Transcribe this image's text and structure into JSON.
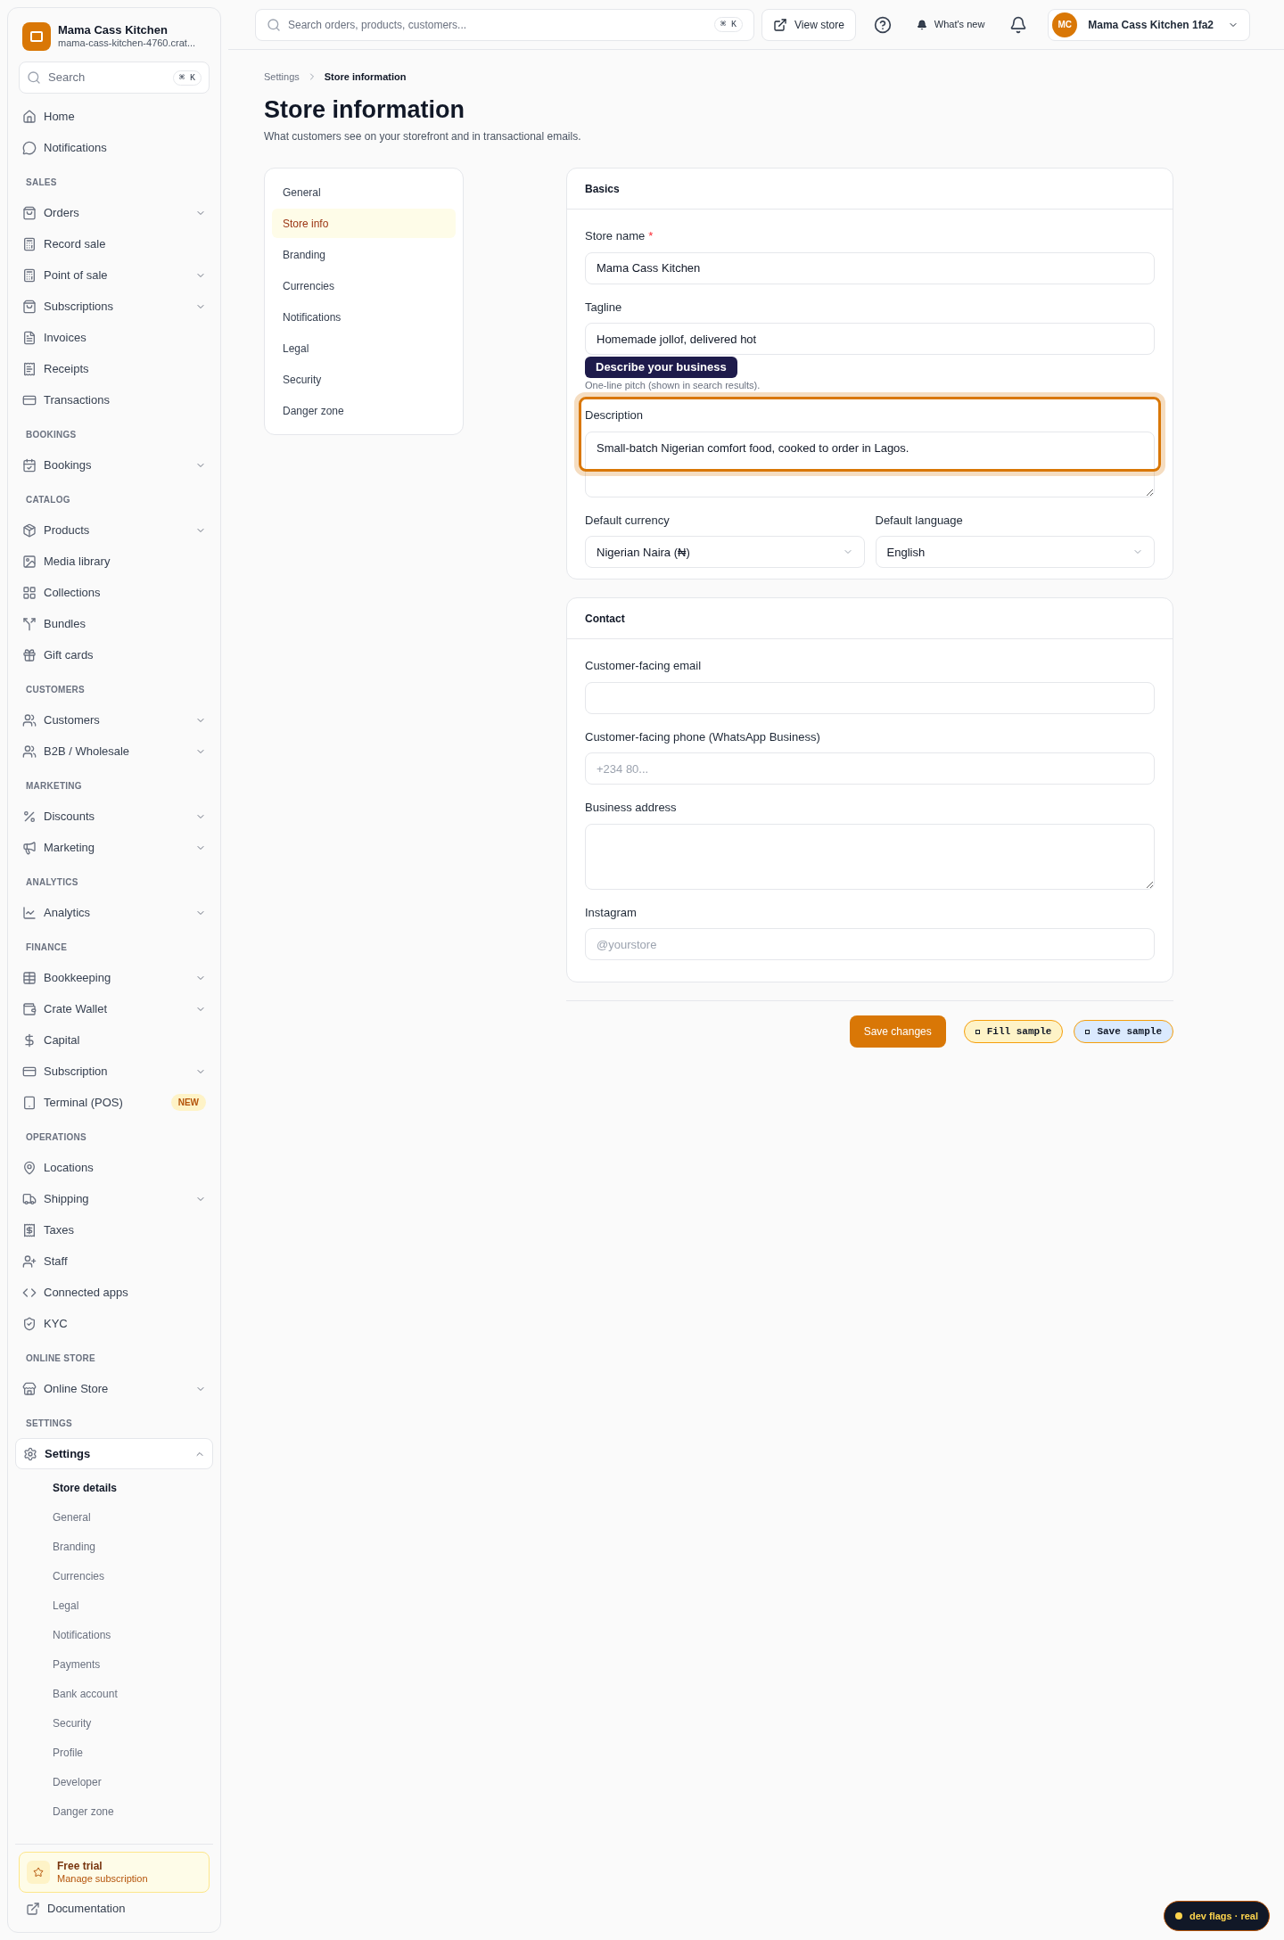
{
  "brand": {
    "name": "Mama Cass Kitchen",
    "subdomain": "mama-cass-kitchen-4760.crat..."
  },
  "sidebar_search": {
    "placeholder": "Search",
    "shortcut": "⌘ K"
  },
  "sidebar": {
    "sections": [
      {
        "items": [
          {
            "label": "Home"
          },
          {
            "label": "Notifications"
          }
        ]
      },
      {
        "label": "SALES",
        "items": [
          {
            "label": "Orders",
            "expanded": false
          },
          {
            "label": "Record sale"
          },
          {
            "label": "Point of sale",
            "expanded": false
          },
          {
            "label": "Subscriptions",
            "expanded": false
          },
          {
            "label": "Invoices"
          },
          {
            "label": "Receipts"
          },
          {
            "label": "Transactions"
          }
        ]
      },
      {
        "label": "BOOKINGS",
        "items": [
          {
            "label": "Bookings",
            "expanded": false
          }
        ]
      },
      {
        "label": "CATALOG",
        "items": [
          {
            "label": "Products",
            "expanded": false
          },
          {
            "label": "Media library"
          },
          {
            "label": "Collections"
          },
          {
            "label": "Bundles"
          },
          {
            "label": "Gift cards"
          }
        ]
      },
      {
        "label": "CUSTOMERS",
        "items": [
          {
            "label": "Customers",
            "expanded": false
          },
          {
            "label": "B2B / Wholesale",
            "expanded": false
          }
        ]
      },
      {
        "label": "MARKETING",
        "items": [
          {
            "label": "Discounts",
            "expanded": false
          },
          {
            "label": "Marketing",
            "expanded": false
          }
        ]
      },
      {
        "label": "ANALYTICS",
        "items": [
          {
            "label": "Analytics",
            "expanded": false
          }
        ]
      },
      {
        "label": "FINANCE",
        "items": [
          {
            "label": "Bookkeeping",
            "expanded": false
          },
          {
            "label": "Crate Wallet",
            "expanded": false
          },
          {
            "label": "Capital"
          },
          {
            "label": "Subscription",
            "expanded": false
          },
          {
            "label": "Terminal (POS)",
            "badge": "NEW"
          }
        ]
      },
      {
        "label": "OPERATIONS",
        "items": [
          {
            "label": "Locations"
          },
          {
            "label": "Shipping",
            "expanded": false
          },
          {
            "label": "Taxes"
          },
          {
            "label": "Staff"
          },
          {
            "label": "Connected apps"
          },
          {
            "label": "KYC"
          }
        ]
      },
      {
        "label": "ONLINE STORE",
        "items": [
          {
            "label": "Online Store",
            "expanded": false
          }
        ]
      },
      {
        "label": "SETTINGS",
        "items": [
          {
            "label": "Settings",
            "expanded": true,
            "selected": true,
            "children": [
              {
                "label": "Store details",
                "selected": true
              },
              {
                "label": "General",
                "selected": false
              },
              {
                "label": "Branding",
                "selected": false
              },
              {
                "label": "Currencies",
                "selected": false
              },
              {
                "label": "Legal",
                "selected": false
              },
              {
                "label": "Notifications",
                "selected": false
              },
              {
                "label": "Payments",
                "selected": false
              },
              {
                "label": "Bank account",
                "selected": false
              },
              {
                "label": "Security",
                "selected": false
              },
              {
                "label": "Profile",
                "selected": false
              },
              {
                "label": "Developer",
                "selected": false
              },
              {
                "label": "Danger zone",
                "selected": false
              }
            ]
          }
        ]
      }
    ]
  },
  "trial": {
    "title": "Free trial",
    "link": "Manage subscription"
  },
  "documentation": "Documentation",
  "topbar": {
    "search_placeholder": "Search orders, products, customers...",
    "shortcut": "⌘ K",
    "view_store": "View store",
    "whats_new": "What's new",
    "avatar": "MC",
    "account": "Mama Cass Kitchen 1fa2"
  },
  "breadcrumb": [
    "Settings",
    "Store information"
  ],
  "page": {
    "title": "Store information",
    "subtitle": "What customers see on your storefront and in transactional emails."
  },
  "settings_nav": [
    {
      "label": "General",
      "selected": false
    },
    {
      "label": "Store info",
      "selected": true
    },
    {
      "label": "Branding",
      "selected": false
    },
    {
      "label": "Currencies",
      "selected": false
    },
    {
      "label": "Notifications",
      "selected": false
    },
    {
      "label": "Legal",
      "selected": false
    },
    {
      "label": "Security",
      "selected": false
    },
    {
      "label": "Danger zone",
      "selected": false
    }
  ],
  "cards": [
    {
      "title": "Basics",
      "fields": [
        {
          "kind": "input",
          "label": "Store name",
          "required_mark": "*",
          "value": "Mama Cass Kitchen"
        },
        {
          "kind": "input",
          "label": "Tagline",
          "value": "Homemade jollof, delivered hot",
          "hint": "One-line pitch (shown in search results)."
        },
        {
          "kind": "textarea",
          "label": "Description",
          "value": "Small-batch Nigerian comfort food, cooked to order in Lagos.",
          "highlighted": true,
          "tooltip": "Describe your business"
        },
        {
          "kind": "select_pair",
          "selects": [
            {
              "label": "Default currency",
              "value": "Nigerian Naira (₦)"
            },
            {
              "label": "Default language",
              "value": "English"
            }
          ]
        }
      ]
    },
    {
      "title": "Contact",
      "fields": [
        {
          "kind": "input",
          "label": "Customer-facing email"
        },
        {
          "kind": "input",
          "label": "Customer-facing phone (WhatsApp Business)",
          "placeholder": "+234 80..."
        },
        {
          "kind": "textarea",
          "label": "Business address"
        },
        {
          "kind": "input",
          "label": "Instagram",
          "placeholder": "@yourstore"
        }
      ]
    }
  ],
  "actions": {
    "save": "Save changes",
    "dev_buttons": [
      {
        "label": "Fill sample",
        "color": "#fef3c7"
      },
      {
        "label": "Save sample",
        "color": "#dbeafe"
      }
    ]
  },
  "dev_flags": "dev flags · real"
}
